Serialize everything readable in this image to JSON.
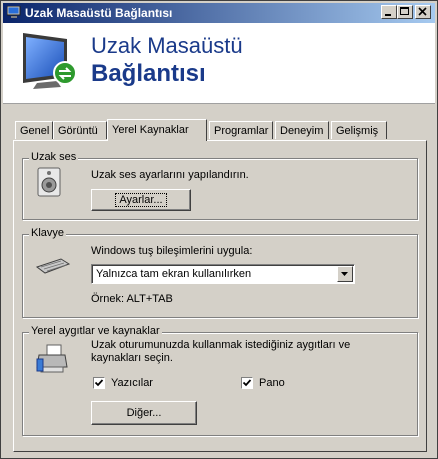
{
  "window": {
    "title": "Uzak Masaüstü Bağlantısı"
  },
  "banner": {
    "line1": "Uzak Masaüstü",
    "line2": "Bağlantısı"
  },
  "tabs": [
    "Genel",
    "Görüntü",
    "Yerel Kaynaklar",
    "Programlar",
    "Deneyim",
    "Gelişmiş"
  ],
  "audio": {
    "group_label": "Uzak ses",
    "description": "Uzak ses ayarlarını yapılandırın.",
    "button": "Ayarlar..."
  },
  "keyboard": {
    "group_label": "Klavye",
    "description": "Windows tuş bileşimlerini uygula:",
    "selected": "Yalnızca tam ekran kullanılırken",
    "example": "Örnek: ALT+TAB"
  },
  "devices": {
    "group_label": "Yerel aygıtlar ve kaynaklar",
    "description_line1": "Uzak oturumunuzda kullanmak istediğiniz aygıtları ve",
    "description_line2": "kaynakları seçin.",
    "printers_label": "Yazıcılar",
    "printers_checked": true,
    "clipboard_label": "Pano",
    "clipboard_checked": true,
    "more_button": "Diğer..."
  }
}
